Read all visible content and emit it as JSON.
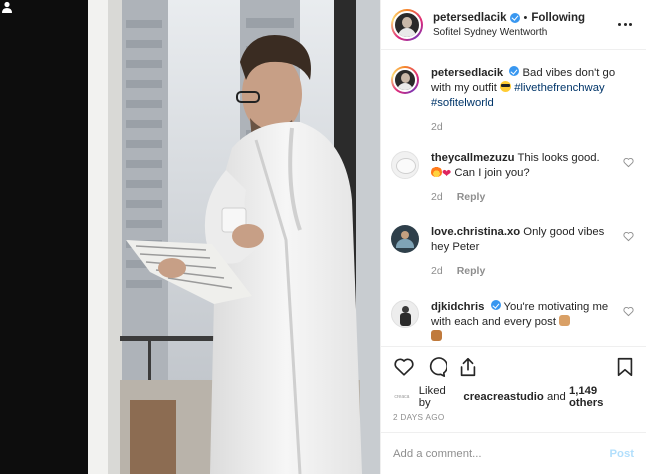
{
  "header": {
    "username": "petersedlacik",
    "follow_state": "Following",
    "location": "Sofitel Sydney Wentworth",
    "more_icon": "more-horizontal-icon"
  },
  "caption": {
    "username": "petersedlacik",
    "text": "Bad vibes don't go with my outfit",
    "hashtags": [
      "#livethefrenchway",
      "#sofitelworld"
    ],
    "age": "2d"
  },
  "comments": [
    {
      "username": "theycallmezuzu",
      "line1": "This looks good.",
      "line2": "Can I join you?",
      "age": "2d",
      "reply": "Reply"
    },
    {
      "username": "love.christina.xo",
      "text": "Only good vibes hey Peter",
      "age": "2d",
      "reply": "Reply"
    },
    {
      "username": "djkidchris",
      "text": "You're motivating me with each and every post"
    }
  ],
  "likes": {
    "avatar_label": "creaca",
    "prefix": "Liked by",
    "user": "creacreastudio",
    "conjunction": "and",
    "count": "1,149 others"
  },
  "timestamp": "2 DAYS AGO",
  "add_comment": {
    "placeholder": "Add a comment...",
    "post_label": "Post"
  },
  "colors": {
    "link": "#003569",
    "verified": "#3897f0",
    "post_disabled": "#b2dffc",
    "muted": "#8e8e8e"
  }
}
